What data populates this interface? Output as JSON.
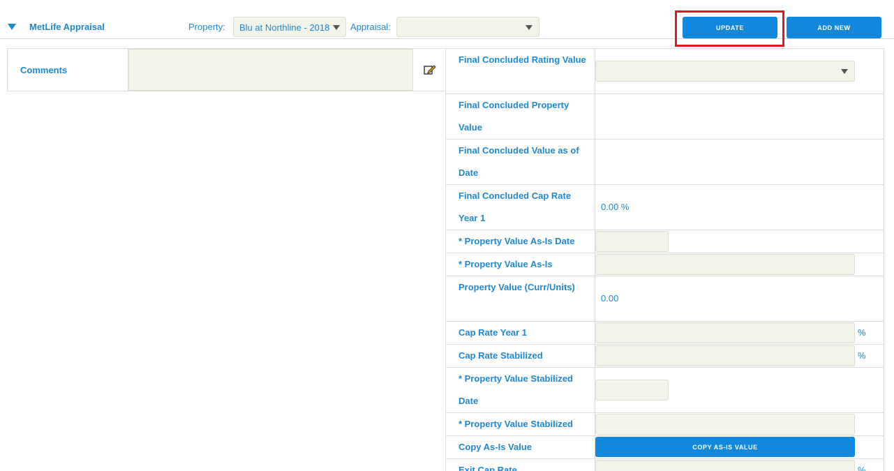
{
  "header": {
    "title": "MetLife Appraisal",
    "property_label": "Property:",
    "property_value": "Blu at Northline - 2018",
    "appraisal_label": "Appraisal:",
    "appraisal_value": "",
    "update_label": "UPDATE",
    "add_new_label": "ADD NEW"
  },
  "comments": {
    "label": "Comments",
    "value": ""
  },
  "form": {
    "rating_label": "Final Concluded Rating Value",
    "rating_value": "",
    "property_value_label": "Final Concluded Property Value",
    "value_date_label": "Final Concluded Value as of Date",
    "cap_rate_label": "Final Concluded Cap Rate Year 1",
    "cap_rate_value": "0.00 %",
    "asis_date_label": "* Property Value As-Is Date",
    "asis_label": "* Property Value As-Is",
    "curr_units_label": "Property Value (Curr/Units)",
    "curr_units_value": "0.00",
    "cap_year1_label": "Cap Rate Year 1",
    "cap_stabilized_label": "Cap Rate Stabilized",
    "stab_date_label": "* Property Value Stabilized Date",
    "stabilized_label": "* Property Value Stabilized",
    "copy_label": "Copy As-Is Value",
    "copy_button": "COPY AS-IS VALUE",
    "exit_cap_label": "Exit Cap Rate",
    "percent_sign": "%"
  },
  "colors": {
    "accent": "#1e88d2",
    "button": "#1288dc",
    "field_bg": "#f1f4e9",
    "highlight": "#e3181f"
  }
}
